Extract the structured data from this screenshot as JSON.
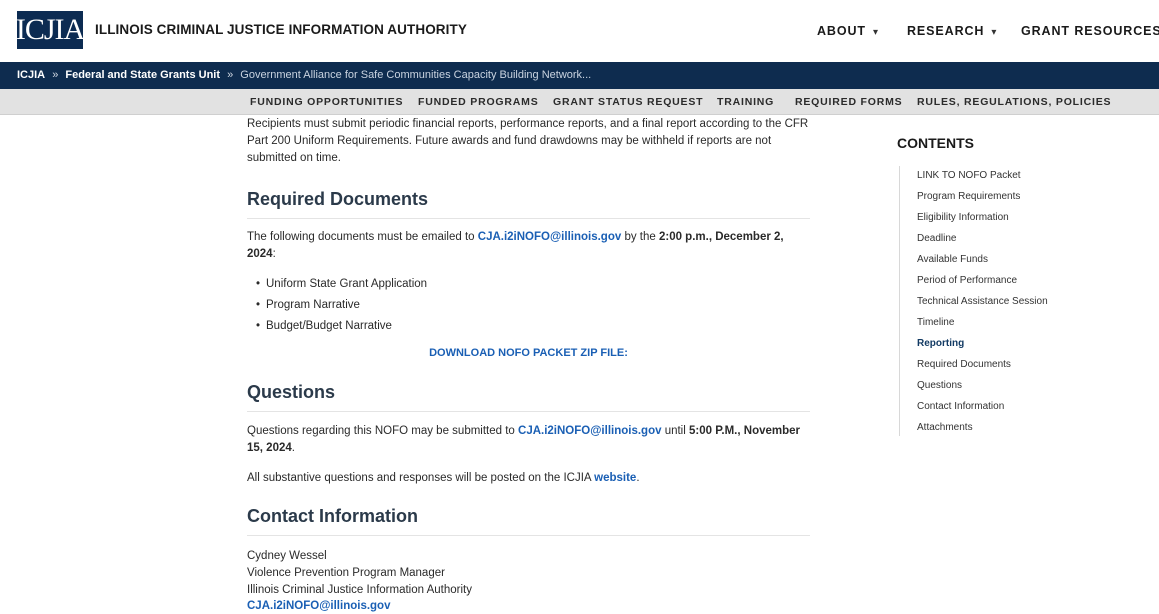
{
  "header": {
    "logo_text": "ICJIA",
    "site_title": "ILLINOIS CRIMINAL JUSTICE INFORMATION AUTHORITY",
    "nav": [
      {
        "label": "ABOUT",
        "caret": "▾"
      },
      {
        "label": "RESEARCH",
        "caret": "▾"
      },
      {
        "label": "GRANT RESOURCES",
        "caret": "▾"
      }
    ]
  },
  "breadcrumb": {
    "root": "ICJIA",
    "sep1": "»",
    "section": "Federal and State Grants Unit",
    "sep2": "»",
    "current": "Government Alliance for Safe Communities Capacity Building Network..."
  },
  "subnav": [
    "FUNDING OPPORTUNITIES",
    "FUNDED PROGRAMS",
    "GRANT STATUS REQUEST",
    "TRAINING",
    "REQUIRED FORMS",
    "RULES, REGULATIONS, POLICIES"
  ],
  "content": {
    "reporting_text": "Recipients must submit periodic financial reports, performance reports, and a final report according to the CFR Part 200 Uniform Requirements. Future awards and fund drawdowns may be withheld if reports are not submitted on time.",
    "required_docs_heading": "Required Documents",
    "required_docs_intro_1": "The following documents must be emailed to ",
    "required_docs_email": "CJA.i2iNOFO@illinois.gov",
    "required_docs_intro_2": " by the ",
    "required_docs_deadline": "2:00 p.m., December 2, 2024",
    "required_docs_intro_3": ":",
    "documents": [
      "Uniform State Grant Application",
      "Program Narrative",
      "Budget/Budget Narrative"
    ],
    "download_label": "DOWNLOAD NOFO PACKET ZIP FILE:",
    "questions_heading": "Questions",
    "questions_text_1": "Questions regarding this NOFO may be submitted to ",
    "questions_email": "CJA.i2iNOFO@illinois.gov",
    "questions_text_2": " until ",
    "questions_deadline": "5:00 P.M., November 15, 2024",
    "questions_text_3": ".",
    "responses_text_1": "All substantive questions and responses will be posted on the ICJIA ",
    "responses_link": "website",
    "responses_text_2": ".",
    "contact_heading": "Contact Information",
    "contact": {
      "name": "Cydney Wessel",
      "title": "Violence Prevention Program Manager",
      "org": "Illinois Criminal Justice Information Authority",
      "email": "CJA.i2iNOFO@illinois.gov"
    }
  },
  "toc": {
    "title": "CONTENTS",
    "items": [
      {
        "label": "LINK TO NOFO Packet",
        "active": false
      },
      {
        "label": "Program Requirements",
        "active": false
      },
      {
        "label": "Eligibility Information",
        "active": false
      },
      {
        "label": "Deadline",
        "active": false
      },
      {
        "label": "Available Funds",
        "active": false
      },
      {
        "label": "Period of Performance",
        "active": false
      },
      {
        "label": "Technical Assistance Session",
        "active": false
      },
      {
        "label": "Timeline",
        "active": false
      },
      {
        "label": "Reporting",
        "active": true
      },
      {
        "label": "Required Documents",
        "active": false
      },
      {
        "label": "Questions",
        "active": false
      },
      {
        "label": "Contact Information",
        "active": false
      },
      {
        "label": "Attachments",
        "active": false
      }
    ]
  },
  "colors": {
    "brand_navy": "#0e2c4f",
    "link_blue": "#1a5fb4",
    "subnav_bg": "#e2e2e2"
  }
}
